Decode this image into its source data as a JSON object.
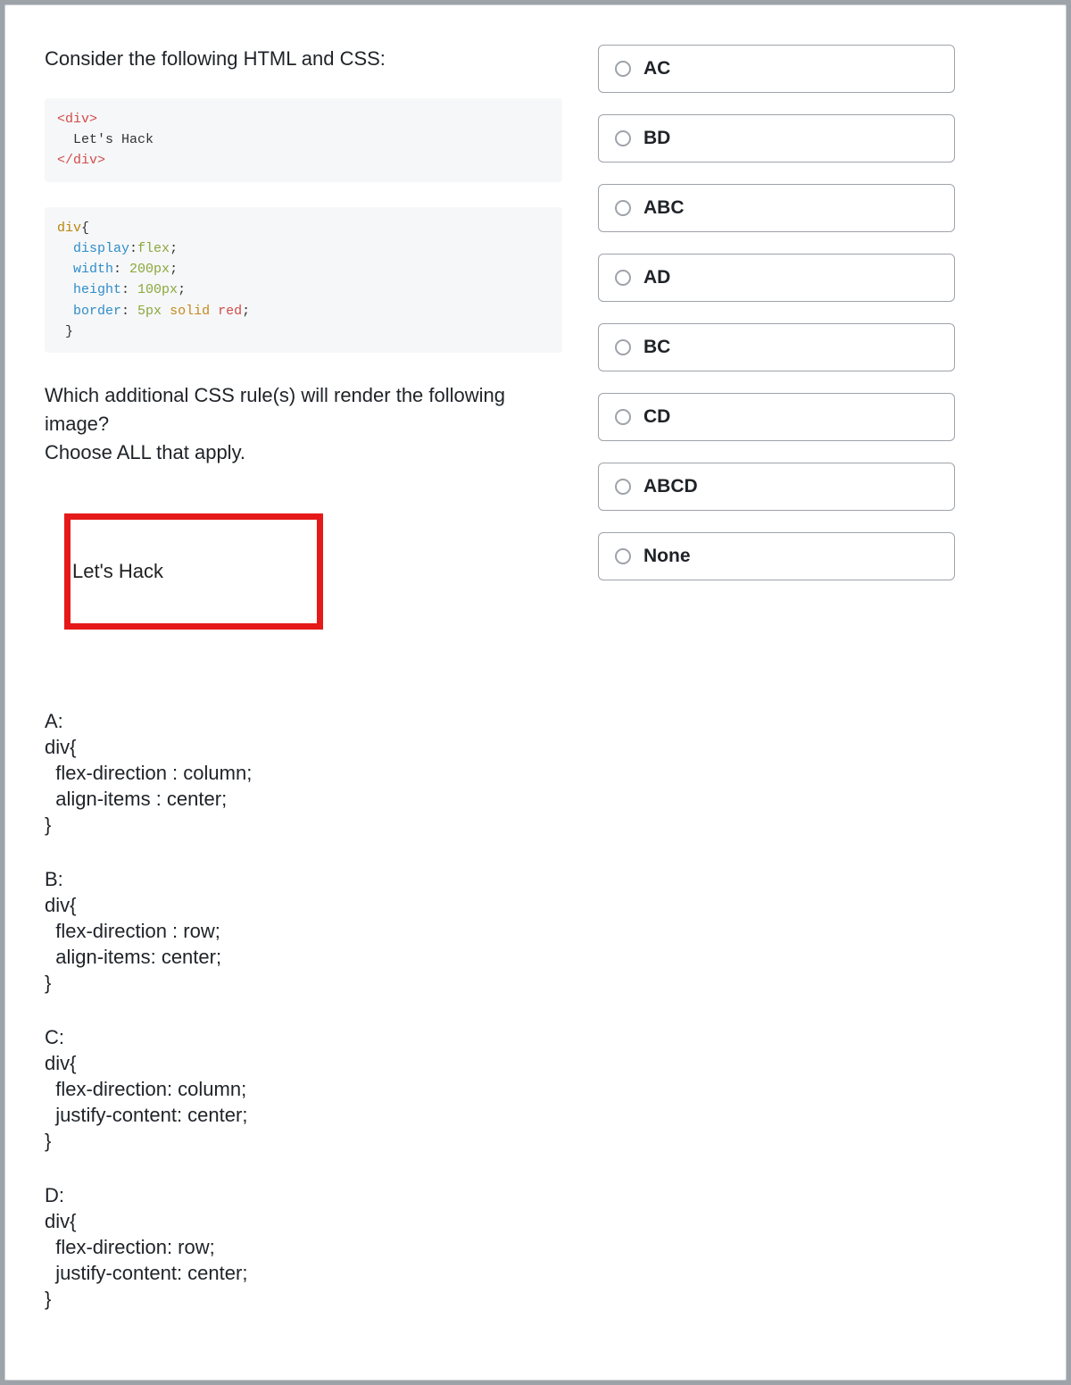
{
  "question": {
    "intro": "Consider the following HTML and CSS:",
    "prompt_line1": "Which additional CSS rule(s) will render the following image?",
    "prompt_line2": "Choose ALL that apply."
  },
  "code_html": {
    "line1_open": "<div>",
    "line2_text": "  Let's Hack",
    "line3_close": "</div>"
  },
  "code_css": {
    "selector": "div",
    "brace_open": "{",
    "p1_name": "display",
    "p1_colon": ":",
    "p1_val": "flex",
    "p1_semi": ";",
    "p2_name": "width",
    "p2_colon": ": ",
    "p2_val": "200px",
    "p2_semi": ";",
    "p3_name": "height",
    "p3_colon": ": ",
    "p3_val": "100px",
    "p3_semi": ";",
    "p4_name": "border",
    "p4_colon": ": ",
    "p4_val_a": "5px",
    "p4_val_b": "solid",
    "p4_val_c": "red",
    "p4_semi": ";",
    "brace_close": " }"
  },
  "render_text": "Let's Hack",
  "snippets": {
    "A": "A:\ndiv{\n  flex-direction : column;\n  align-items : center;\n}",
    "B": "B:\ndiv{\n  flex-direction : row;\n  align-items: center;\n}",
    "C": "C:\ndiv{\n  flex-direction: column;\n  justify-content: center;\n}",
    "D": "D:\ndiv{\n  flex-direction: row;\n  justify-content: center;\n}"
  },
  "options": [
    {
      "label": "AC"
    },
    {
      "label": "BD"
    },
    {
      "label": "ABC"
    },
    {
      "label": "AD"
    },
    {
      "label": "BC"
    },
    {
      "label": "CD"
    },
    {
      "label": "ABCD"
    },
    {
      "label": "None"
    }
  ]
}
